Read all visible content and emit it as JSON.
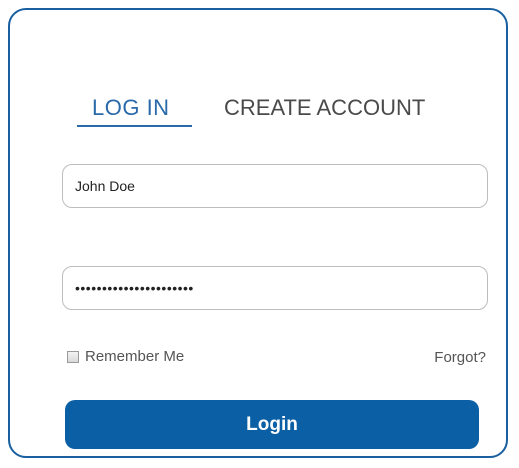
{
  "tabs": {
    "login_label": "LOG IN",
    "create_label": "CREATE ACCOUNT",
    "active": "login"
  },
  "form": {
    "username_value": "John Doe",
    "password_value": "••••••••••••••••••••••",
    "remember_label": "Remember Me",
    "remember_checked": false,
    "forgot_label": "Forgot?",
    "submit_label": "Login"
  },
  "colors": {
    "accent": "#0b5fa5",
    "tab_active": "#2a6aaa",
    "border": "#1a5fa0"
  }
}
